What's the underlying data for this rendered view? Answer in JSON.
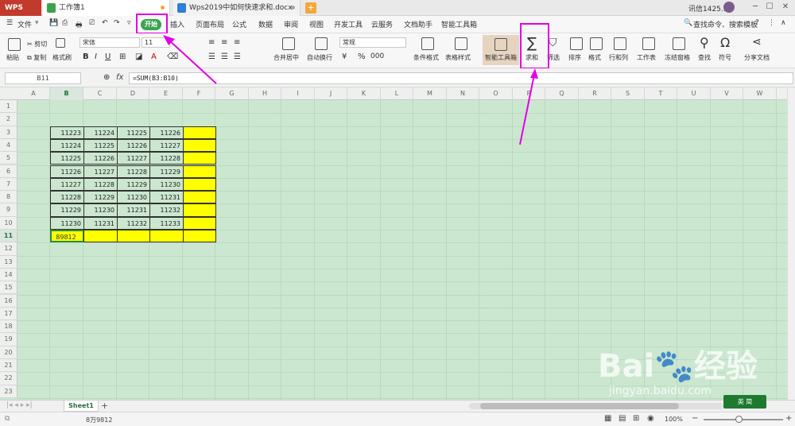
{
  "titlebar": {
    "app_button": "WPS",
    "tabs": [
      {
        "label": "工作簿1",
        "icon": "spreadsheet-icon",
        "color": "#3aa34f"
      },
      {
        "label": "Wps2019中如何快速求和.docx",
        "icon": "document-icon",
        "color": "#2f7fd6"
      }
    ],
    "user": "讯信1425..."
  },
  "menubar": {
    "file": "文件",
    "items": [
      "开始",
      "插入",
      "页面布局",
      "公式",
      "数据",
      "审阅",
      "视图",
      "开发工具",
      "云服务",
      "文档助手",
      "智能工具箱"
    ],
    "search": "查找命令、搜索模板"
  },
  "toolbar": {
    "paste": "粘贴",
    "cut": "剪切",
    "copy": "复制",
    "format_painter": "格式刷",
    "font_name": "宋体",
    "font_size": "11",
    "merge_center": "合并居中",
    "wrap": "自动换行",
    "number_format": "常规",
    "cond_format": "条件格式",
    "table_style": "表格样式",
    "smart_toolbox": "智能工具箱",
    "sum": "求和",
    "filter": "筛选",
    "sort": "排序",
    "format": "格式",
    "row_col": "行和列",
    "worksheet": "工作表",
    "freeze": "冻结窗格",
    "find": "查找",
    "symbol": "符号",
    "share": "分享文档"
  },
  "formulabar": {
    "namebox": "B11",
    "fx": "fx",
    "formula": "=SUM(B3:B10)"
  },
  "grid": {
    "columns": [
      "A",
      "B",
      "C",
      "D",
      "E",
      "F",
      "G",
      "H",
      "I",
      "J",
      "K",
      "L",
      "M",
      "N",
      "O",
      "P",
      "Q",
      "R",
      "S",
      "T",
      "U",
      "V",
      "W"
    ],
    "rows": [
      "1",
      "2",
      "3",
      "4",
      "5",
      "6",
      "7",
      "8",
      "9",
      "10",
      "11",
      "12",
      "13",
      "14",
      "15",
      "16",
      "17",
      "18",
      "19",
      "20",
      "21",
      "22",
      "23"
    ],
    "data": [
      [
        "11223",
        "11224",
        "11225",
        "11226"
      ],
      [
        "11224",
        "11225",
        "11226",
        "11227"
      ],
      [
        "11225",
        "11226",
        "11227",
        "11228"
      ],
      [
        "11226",
        "11227",
        "11228",
        "11229"
      ],
      [
        "11227",
        "11228",
        "11229",
        "11230"
      ],
      [
        "11228",
        "11229",
        "11230",
        "11231"
      ],
      [
        "11229",
        "11230",
        "11231",
        "11232"
      ],
      [
        "11230",
        "11231",
        "11232",
        "11233"
      ]
    ],
    "sum_value": "89812",
    "selected_cell": "B11"
  },
  "sheetbar": {
    "sheet": "Sheet1",
    "add": "+"
  },
  "statusbar": {
    "sum_text": "8万9812",
    "zoom": "100%"
  },
  "watermark": {
    "main": "Bai🐾经验",
    "sub": "jingyan.baidu.com"
  },
  "badge": "英 简"
}
